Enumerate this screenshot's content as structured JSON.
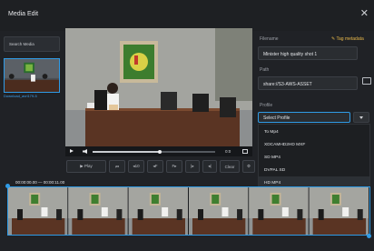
{
  "window": {
    "title": "Media Edit",
    "close_glyph": "✕"
  },
  "sidebar": {
    "search_placeholder": "Search Media",
    "items": [
      {
        "caption": "Download_avrl179-5"
      }
    ]
  },
  "player": {
    "current_time": "0:0",
    "progress": 0.55
  },
  "toolbar": {
    "buttons": [
      {
        "label": "▶ Play",
        "icon": "play-icon"
      },
      {
        "label": "⏮",
        "icon": "first-frame-icon"
      },
      {
        "label": "◂10",
        "icon": "back-10-icon"
      },
      {
        "label": "◂F",
        "icon": "back-frame-icon"
      },
      {
        "label": "F▸",
        "icon": "forward-frame-icon"
      },
      {
        "label": "|▸",
        "icon": "mark-in-icon"
      },
      {
        "label": "◂|",
        "icon": "mark-out-icon"
      },
      {
        "label": "Clear",
        "icon": "clear-icon"
      },
      {
        "label": "⚙",
        "icon": "settings-icon"
      }
    ]
  },
  "details": {
    "filename_label": "Filename",
    "tag_metadata": "✎ Tag metadata",
    "filename_value": "Minister high quality shot 1",
    "path_label": "Path",
    "path_value": "share://S3-AWS-ASSET",
    "profile_label": "Profile",
    "profile_value": "Select Profile",
    "profile_options": [
      "To Mp4",
      "XDCAMHD2HD MXF",
      "SD MP4",
      "DVPAL SD",
      "HD MP4"
    ]
  },
  "timeline": {
    "range": "00:00:00.00 — 00:00:11.00",
    "frame_count": 6
  },
  "colors": {
    "accent": "#2f9be6",
    "tag": "#e8b84a",
    "background": "#202226"
  }
}
